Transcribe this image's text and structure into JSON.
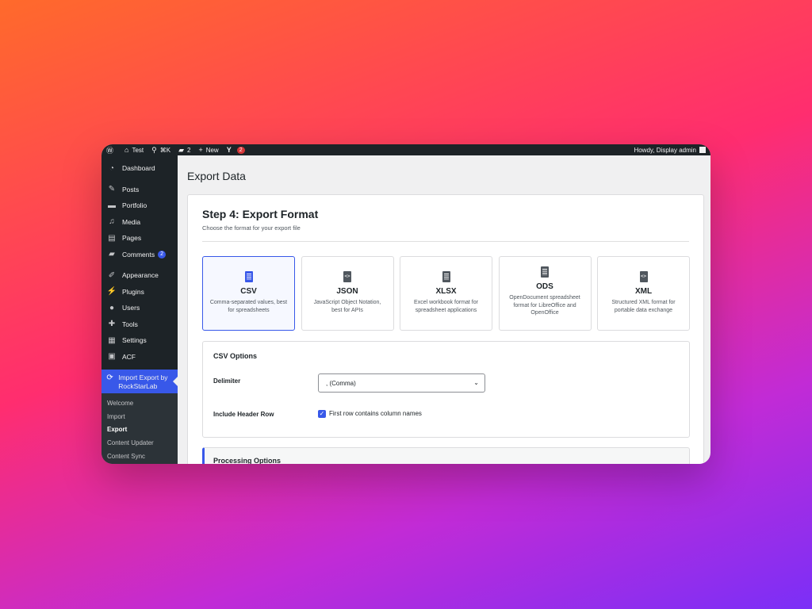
{
  "adminbar": {
    "site_name": "Test",
    "shortcut": "⌘K",
    "comments_count": "2",
    "new_label": "New",
    "yoast_count": "2",
    "howdy": "Howdy, Display admin"
  },
  "sidebar": {
    "items": [
      {
        "label": "Dashboard",
        "icon": "dashboard-icon"
      },
      {
        "label": "Posts",
        "icon": "pin-icon"
      },
      {
        "label": "Portfolio",
        "icon": "folder-icon"
      },
      {
        "label": "Media",
        "icon": "media-icon"
      },
      {
        "label": "Pages",
        "icon": "pages-icon"
      },
      {
        "label": "Comments",
        "icon": "comment-icon",
        "count": "2"
      },
      {
        "label": "Appearance",
        "icon": "brush-icon"
      },
      {
        "label": "Plugins",
        "icon": "plugin-icon"
      },
      {
        "label": "Users",
        "icon": "user-icon"
      },
      {
        "label": "Tools",
        "icon": "wrench-icon"
      },
      {
        "label": "Settings",
        "icon": "settings-icon"
      },
      {
        "label": "ACF",
        "icon": "acf-icon"
      }
    ],
    "active": {
      "label": "Import Export by RockStarLab",
      "icon": "sync-icon"
    },
    "submenu": [
      "Welcome",
      "Import",
      "Export",
      "Content Updater",
      "Content Sync"
    ]
  },
  "page": {
    "title": "Export Data",
    "step_title": "Step 4: Export Format",
    "step_subtitle": "Choose the format for your export file"
  },
  "formats": [
    {
      "name": "CSV",
      "desc": "Comma-separated values, best for spreadsheets",
      "selected": true
    },
    {
      "name": "JSON",
      "desc": "JavaScript Object Notation, best for APIs"
    },
    {
      "name": "XLSX",
      "desc": "Excel workbook format for spreadsheet applications"
    },
    {
      "name": "ODS",
      "desc": "OpenDocument spreadsheet format for LibreOffice and OpenOffice"
    },
    {
      "name": "XML",
      "desc": "Structured XML format for portable data exchange"
    }
  ],
  "csv_options": {
    "title": "CSV Options",
    "delimiter_label": "Delimiter",
    "delimiter_value": ", (Comma)",
    "header_label": "Include Header Row",
    "header_checkbox_label": "First row contains column names",
    "header_checked": true
  },
  "processing": {
    "title": "Processing Options"
  },
  "colors": {
    "accent": "#3858e9",
    "adminbar_bg": "#1d2327",
    "badge_red": "#d63638"
  }
}
